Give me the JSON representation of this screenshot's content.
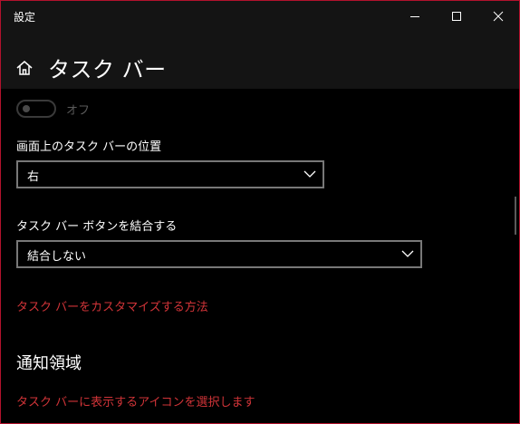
{
  "window": {
    "app_title": "設定",
    "accent_color": "#b3122d"
  },
  "header": {
    "title": "タスク バー",
    "home_icon": "home-icon"
  },
  "toggle": {
    "state_label": "オフ",
    "is_on": false
  },
  "taskbar_position": {
    "label": "画面上のタスク バーの位置",
    "selected": "右"
  },
  "combine_buttons": {
    "label": "タスク バー ボタンを結合する",
    "selected": "結合しない"
  },
  "links": {
    "customize": "タスク バーをカスタマイズする方法",
    "select_icons": "タスク バーに表示するアイコンを選択します"
  },
  "notification_area": {
    "heading": "通知領域"
  },
  "colors": {
    "link": "#d13438",
    "background": "#000000",
    "header_bg": "#141414"
  }
}
